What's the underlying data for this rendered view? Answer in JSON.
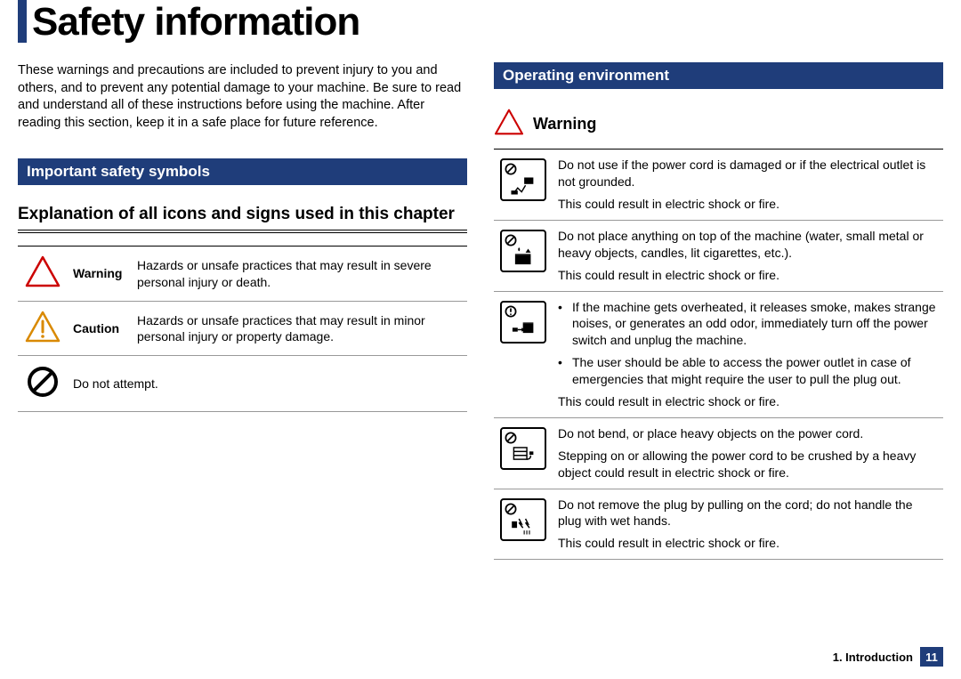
{
  "title": "Safety information",
  "intro": "These warnings and precautions are included to prevent injury to you and others, and to prevent any potential damage to your machine. Be sure to read and understand all of these instructions before using the machine. After reading this section, keep it in a safe place for future reference.",
  "footer": {
    "chapter": "1. Introduction",
    "page": "11"
  },
  "left": {
    "section_bar": "Important safety symbols",
    "subheading": "Explanation of all icons and signs used in this chapter",
    "symbols": [
      {
        "label": "Warning",
        "desc": "Hazards or unsafe practices that may result in severe personal injury or death."
      },
      {
        "label": "Caution",
        "desc": "Hazards or unsafe practices that may result in minor personal injury or property damage."
      },
      {
        "label": "",
        "desc": "Do not attempt."
      }
    ]
  },
  "right": {
    "section_bar": "Operating environment",
    "warning_label": "Warning",
    "rows": [
      {
        "line1": "Do not use if the power cord is damaged or if the electrical outlet is not grounded.",
        "line2": "This could result in electric shock or fire."
      },
      {
        "line1": "Do not place anything on top of the machine (water, small metal or heavy objects, candles, lit cigarettes, etc.).",
        "line2": "This could result in electric shock or fire."
      },
      {
        "bullet1": "If the machine gets overheated, it releases smoke, makes strange noises, or generates an odd odor, immediately turn off the power switch and unplug the machine.",
        "bullet2": "The user should be able to access the power outlet in case of emergencies that might require the user to pull the plug out.",
        "line2": "This could result in electric shock or fire."
      },
      {
        "line1": "Do not bend, or place heavy objects on the power cord.",
        "line2": "Stepping on or allowing the power cord to be crushed by a heavy object could result in electric shock or fire."
      },
      {
        "line1": "Do not remove the plug by pulling on the cord; do not handle the plug with wet hands.",
        "line2": "This could result in electric shock or fire."
      }
    ]
  }
}
